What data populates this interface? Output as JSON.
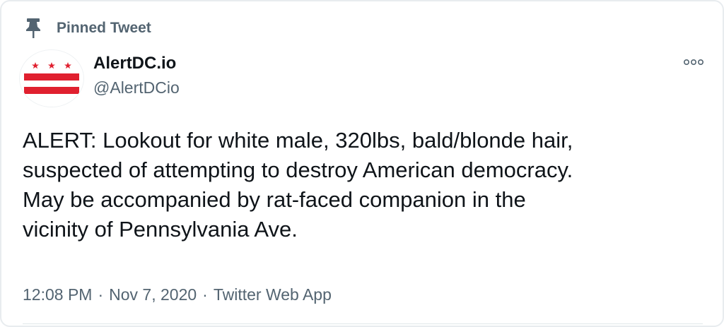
{
  "pinned": {
    "icon": "pin-icon",
    "label": "Pinned Tweet"
  },
  "author": {
    "avatar_icon": "dc-flag-avatar",
    "display_name": "AlertDC.io",
    "handle": "@AlertDCio"
  },
  "more": {
    "icon": "more-options-icon"
  },
  "tweet": {
    "text": "ALERT: Lookout for white male, 320lbs, bald/blonde hair,\nsuspected of attempting to destroy American democracy.\nMay be accompanied by rat-faced companion in the\nvicinity of Pennsylvania Ave."
  },
  "meta": {
    "time": "12:08 PM",
    "separator": "·",
    "date": "Nov 7, 2020",
    "source": "Twitter Web App"
  },
  "colors": {
    "flag_red": "#e0202f",
    "muted_text": "#536471",
    "primary_text": "#0f1419"
  }
}
